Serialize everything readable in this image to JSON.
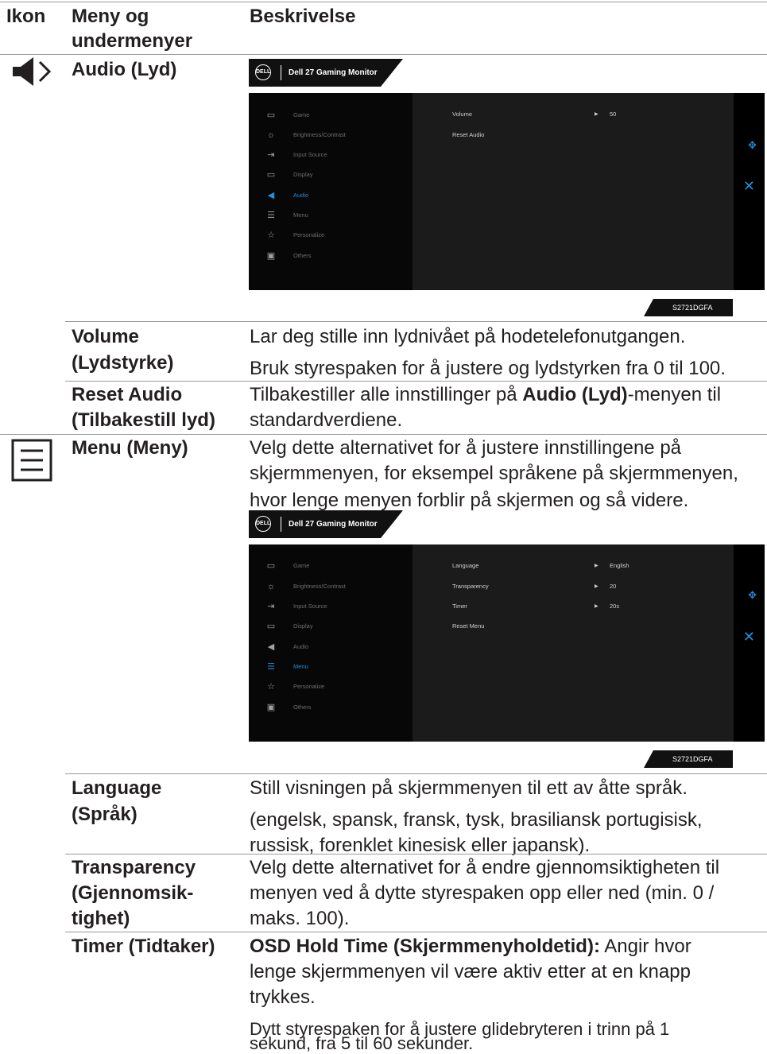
{
  "header": {
    "col_icon": "Ikon",
    "col_menu_1": "Meny og",
    "col_menu_2": "undermenyer",
    "col_desc": "Beskrivelse"
  },
  "audio_row": {
    "term": "Audio (Lyd)",
    "icon": "speaker-icon"
  },
  "osd_common": {
    "brand": "DELL",
    "title": "Dell 27 Gaming Monitor",
    "model": "S2721DGFA",
    "menu_items": [
      "Game",
      "Brightness/Contrast",
      "Input Source",
      "Display",
      "Audio",
      "Menu",
      "Personalize",
      "Others"
    ]
  },
  "osd_audio": {
    "active": "Audio",
    "options": [
      {
        "label": "Volume",
        "value": "50"
      },
      {
        "label": "Reset Audio",
        "value": ""
      }
    ]
  },
  "volume": {
    "term_1": "Volume",
    "term_2": "(Lydstyrke)",
    "desc_1": "Lar deg stille inn lydnivået på hodetelefonutgangen.",
    "desc_2": "Bruk styrespaken for å justere og lydstyrken fra 0 til 100."
  },
  "reset_audio": {
    "term_1": "Reset Audio",
    "term_2": "(Tilbakestill lyd)",
    "desc_1a": "Tilbakestiller alle innstillinger på ",
    "desc_1b": "Audio (Lyd)",
    "desc_1c": "-menyen til",
    "desc_2": "standardverdiene."
  },
  "menu_row": {
    "term": "Menu (Meny)",
    "icon": "menu-list-icon",
    "desc_1": "Velg dette alternativet for å justere innstillingene på",
    "desc_2": "skjermmenyen, for eksempel språkene på skjermmenyen,",
    "desc_3": "hvor lenge menyen forblir på skjermen og så videre."
  },
  "osd_menu": {
    "active": "Menu",
    "options": [
      {
        "label": "Language",
        "value": "English"
      },
      {
        "label": "Transparency",
        "value": "20"
      },
      {
        "label": "Timer",
        "value": "20s"
      },
      {
        "label": "Reset Menu",
        "value": ""
      }
    ]
  },
  "language": {
    "term_1": "Language",
    "term_2": "(Språk)",
    "desc_1": "Still visningen på skjermmenyen til ett av åtte språk.",
    "desc_2": "(engelsk, spansk, fransk, tysk, brasiliansk portugisisk,",
    "desc_3": "russisk, forenklet kinesisk eller japansk)."
  },
  "transparency": {
    "term_1": "Transparency",
    "term_2": "(Gjennomsik-",
    "term_3": "tighet)",
    "desc_1": "Velg dette alternativet for å endre gjennomsiktigheten til",
    "desc_2": "menyen ved å dytte styrespaken opp eller ned (min. 0 /",
    "desc_3": "maks. 100)."
  },
  "timer": {
    "term": "Timer (Tidtaker)",
    "desc_1a": "OSD Hold Time (Skjermmenyholdetid):",
    "desc_1b": " Angir hvor",
    "desc_2": "lenge skjermmenyen vil være aktiv etter at en knapp",
    "desc_3": "trykkes.",
    "desc_4": "Dytt styrespaken for å justere glidebryteren i trinn på 1",
    "desc_5": "sekund, fra 5 til 60 sekunder."
  }
}
